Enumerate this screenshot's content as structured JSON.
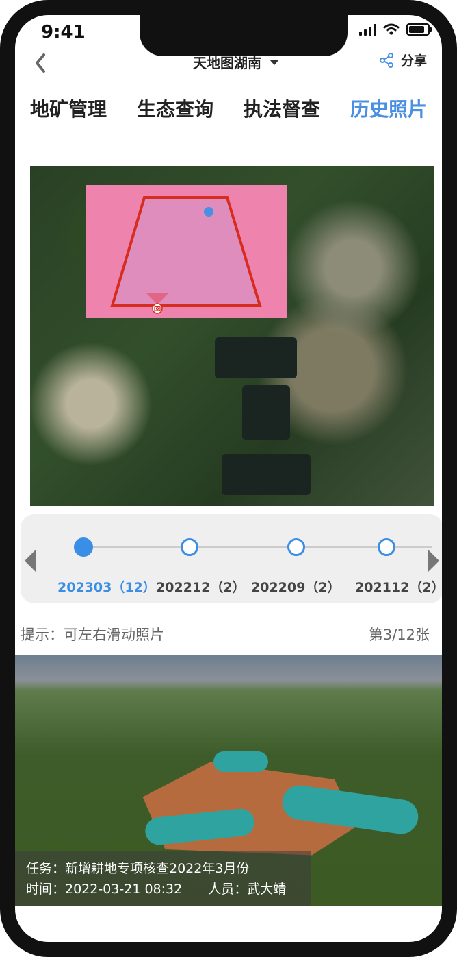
{
  "status_bar": {
    "time": "9:41"
  },
  "header": {
    "layer_selector": "天地图湖南",
    "share_label": "分享"
  },
  "tabs": [
    {
      "label": "地矿管理",
      "active": false
    },
    {
      "label": "生态查询",
      "active": false
    },
    {
      "label": "执法督查",
      "active": false
    },
    {
      "label": "历史照片",
      "active": true
    }
  ],
  "timeline": {
    "items": [
      {
        "label": "202303（12）",
        "active": true
      },
      {
        "label": "202212（2）",
        "active": false
      },
      {
        "label": "202209（2）",
        "active": false
      },
      {
        "label": "202112（2）",
        "active": false
      }
    ]
  },
  "hint": "提示：可左右滑动照片",
  "counter": "第3/12张",
  "photo_caption": {
    "task": "任务：新增耕地专项核查2022年3月份",
    "time": "时间：2022-03-21 08:32",
    "person": "人员：武大靖"
  },
  "colors": {
    "accent": "#4a90e2",
    "overlay": "#ee84ad",
    "polygon": "#d62d20"
  }
}
